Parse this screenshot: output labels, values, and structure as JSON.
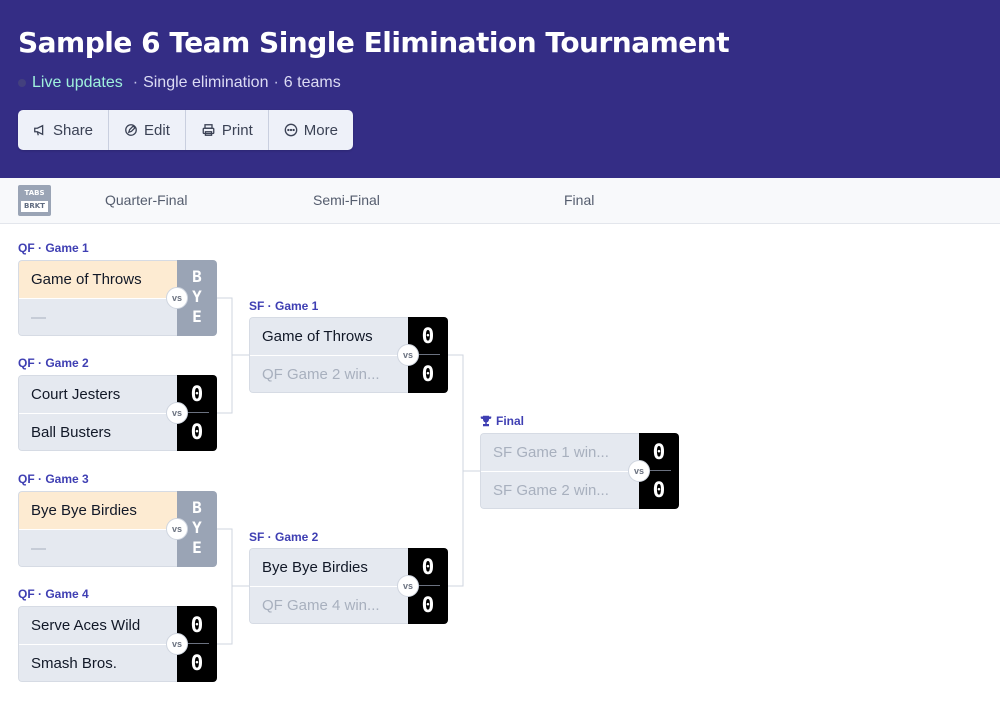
{
  "header": {
    "title": "Sample 6 Team Single Elimination Tournament",
    "live": "Live  updates",
    "format": "Single elimination",
    "teams": "6 teams",
    "separator": "·",
    "actions": [
      {
        "label": "Share",
        "icon": "megaphone-icon"
      },
      {
        "label": "Edit",
        "icon": "edit-icon"
      },
      {
        "label": "Print",
        "icon": "printer-icon"
      },
      {
        "label": "More",
        "icon": "more-icon"
      }
    ]
  },
  "logo": {
    "line1": "TABS",
    "line2": "BRKT"
  },
  "rounds": [
    "Quarter-Final",
    "Semi-Final",
    "Final"
  ],
  "vs_label": "vs",
  "bye_label": [
    "B",
    "Y",
    "E"
  ],
  "games": {
    "qf1": {
      "label": "QF · Game 1",
      "team1": "Game of Throws",
      "team2": "—"
    },
    "qf2": {
      "label": "QF · Game 2",
      "team1": "Court Jesters",
      "team2": "Ball Busters",
      "score1": "0",
      "score2": "0"
    },
    "qf3": {
      "label": "QF · Game 3",
      "team1": "Bye Bye Birdies",
      "team2": "—"
    },
    "qf4": {
      "label": "QF · Game 4",
      "team1": "Serve Aces Wild",
      "team2": "Smash Bros.",
      "score1": "0",
      "score2": "0"
    },
    "sf1": {
      "label": "SF · Game 1",
      "team1": "Game of Throws",
      "team2": "QF Game 2 win...",
      "score1": "0",
      "score2": "0"
    },
    "sf2": {
      "label": "SF · Game 2",
      "team1": "Bye Bye Birdies",
      "team2": "QF Game 4 win...",
      "score1": "0",
      "score2": "0"
    },
    "final": {
      "label": "Final",
      "team1": "SF Game 1 win...",
      "team2": "SF Game 2 win...",
      "score1": "0",
      "score2": "0"
    }
  },
  "colors": {
    "header_bg": "#342d85",
    "live_text": "#9ff1dd",
    "winner_slot": "#fdebd2",
    "slot_bg": "#e5e9f0",
    "score_bg": "#000000",
    "bye_bg": "#9aa4b5",
    "game_label": "#3f3fb3"
  }
}
